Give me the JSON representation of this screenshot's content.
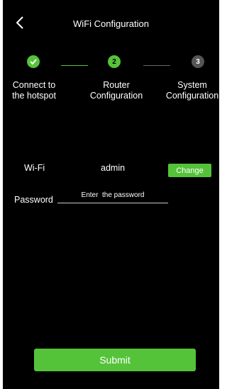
{
  "header": {
    "title": "WiFi Configuration",
    "back_icon": "chevron-left-icon"
  },
  "steps": [
    {
      "badge": "",
      "label_line1": "Connect to",
      "label_line2": "the hotspot",
      "status": "done",
      "icon": "check-icon"
    },
    {
      "badge": "2",
      "label_line1": "Router",
      "label_line2": "Configuration",
      "status": "active"
    },
    {
      "badge": "3",
      "label_line1": "System",
      "label_line2": "Configuration",
      "status": "pending"
    }
  ],
  "form": {
    "wifi_label": "Wi-Fi",
    "wifi_value": "admin",
    "change_label": "Change",
    "password_label": "Password",
    "password_placeholder": "Enter  the password",
    "password_value": ""
  },
  "submit_label": "Submit",
  "colors": {
    "accent": "#55c33a",
    "background": "#000000",
    "inactive": "#555555"
  }
}
